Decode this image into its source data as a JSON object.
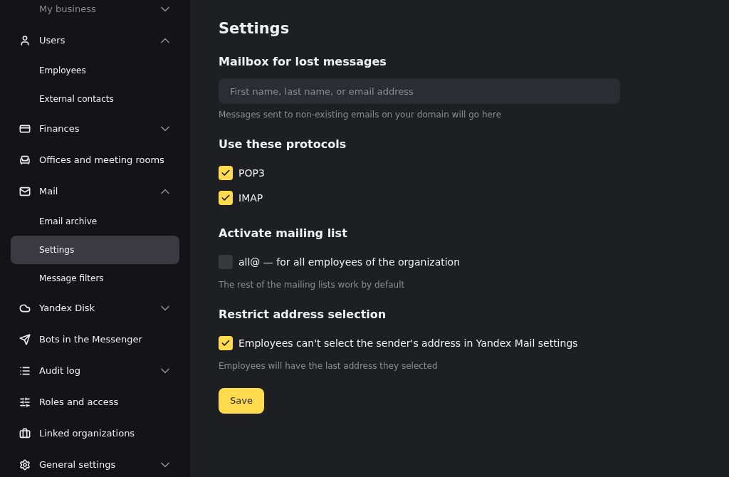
{
  "sidebar": {
    "items": [
      {
        "label": "My business",
        "dimmed": true,
        "expanded": false
      },
      {
        "label": "Users",
        "dimmed": false,
        "expanded": true,
        "children": [
          {
            "label": "Employees",
            "selected": false
          },
          {
            "label": "External contacts",
            "selected": false
          }
        ]
      },
      {
        "label": "Finances",
        "dimmed": false,
        "expanded": false
      },
      {
        "label": "Offices and meeting rooms",
        "dimmed": false
      },
      {
        "label": "Mail",
        "dimmed": false,
        "expanded": true,
        "children": [
          {
            "label": "Email archive",
            "selected": false
          },
          {
            "label": "Settings",
            "selected": true
          },
          {
            "label": "Message filters",
            "selected": false
          }
        ]
      },
      {
        "label": "Yandex Disk",
        "dimmed": false,
        "expanded": false
      },
      {
        "label": "Bots in the Messenger",
        "dimmed": false
      },
      {
        "label": "Audit log",
        "dimmed": false,
        "expanded": false
      },
      {
        "label": "Roles and access",
        "dimmed": false
      },
      {
        "label": "Linked organizations",
        "dimmed": false
      },
      {
        "label": "General settings",
        "dimmed": false,
        "expanded": false
      }
    ]
  },
  "page": {
    "title": "Settings",
    "sections": [
      {
        "heading": "Mailbox for lost messages",
        "kind": "field",
        "placeholder": "First name, last name, or email address",
        "hint": "Messages sent to non-existing emails on your domain will go here"
      },
      {
        "heading": "Use these protocols",
        "kind": "checkboxes",
        "options": [
          {
            "label": "POP3",
            "checked": true
          },
          {
            "label": "IMAP",
            "checked": true
          }
        ]
      },
      {
        "heading": "Activate mailing list",
        "kind": "checkboxes",
        "options": [
          {
            "label": "all@ — for all employees of the organization",
            "checked": false
          }
        ],
        "hint": "The rest of the mailing lists work by default"
      },
      {
        "heading": "Restrict address selection",
        "kind": "checkboxes",
        "options": [
          {
            "label": "Employees can't select the sender's address in Yandex Mail settings",
            "checked": true
          }
        ],
        "hint": "Employees will have the last address they selected"
      }
    ],
    "save_button": "Save"
  }
}
